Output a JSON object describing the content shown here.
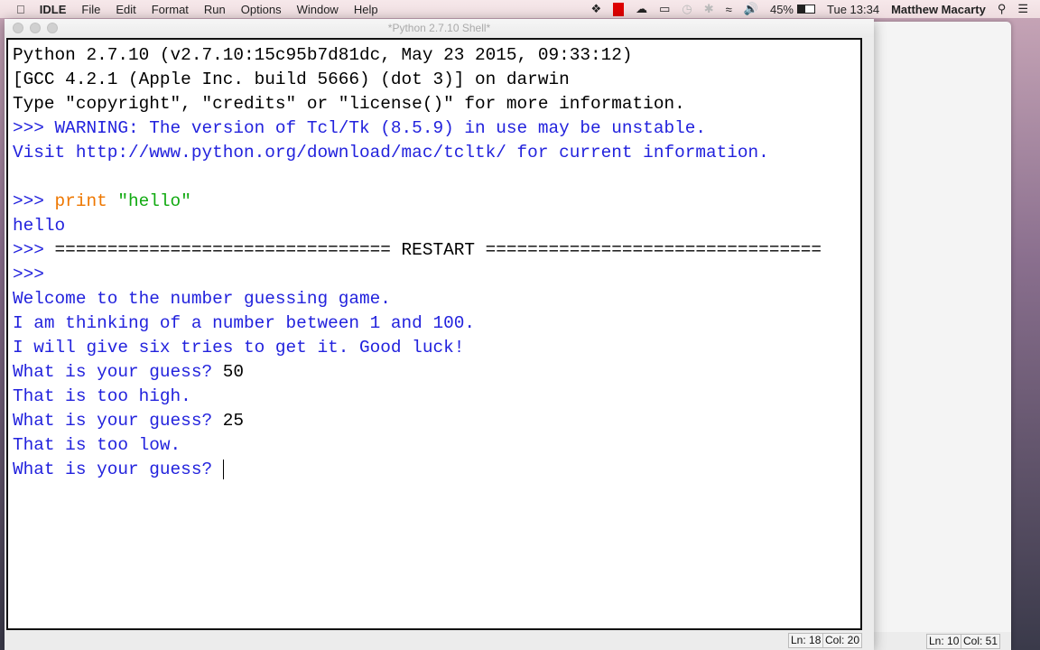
{
  "menubar": {
    "app": "IDLE",
    "items": [
      "File",
      "Edit",
      "Format",
      "Run",
      "Options",
      "Window",
      "Help"
    ],
    "battery": "45%",
    "clock": "Tue 13:34",
    "user": "Matthew Macarty"
  },
  "window": {
    "title": "*Python 2.7.10 Shell*"
  },
  "shell": {
    "lines": [
      [
        {
          "t": "Python 2.7.10 (v2.7.10:15c95b7d81dc, May 23 2015, 09:33:12)",
          "c": "blk"
        }
      ],
      [
        {
          "t": "[GCC 4.2.1 (Apple Inc. build 5666) (dot 3)] on darwin",
          "c": "blk"
        }
      ],
      [
        {
          "t": "Type \"copyright\", \"credits\" or \"license()\" for more information.",
          "c": "blk"
        }
      ],
      [
        {
          "t": ">>> WARNING: The version of Tcl/Tk (8.5.9) in use may be unstable.",
          "c": "blu"
        }
      ],
      [
        {
          "t": "Visit http://www.python.org/download/mac/tcltk/ for current information.",
          "c": "blu"
        }
      ],
      [
        {
          "t": "",
          "c": "blk"
        }
      ],
      [
        {
          "t": ">>> ",
          "c": "blu"
        },
        {
          "t": "print ",
          "c": "org"
        },
        {
          "t": "\"hello\"",
          "c": "grn"
        }
      ],
      [
        {
          "t": "hello",
          "c": "blu"
        }
      ],
      [
        {
          "t": ">>> ",
          "c": "blu"
        },
        {
          "t": "================================ RESTART ================================",
          "c": "blk"
        }
      ],
      [
        {
          "t": ">>> ",
          "c": "blu"
        }
      ],
      [
        {
          "t": "Welcome to the number guessing game.",
          "c": "blu"
        }
      ],
      [
        {
          "t": "I am thinking of a number between 1 and 100.",
          "c": "blu"
        }
      ],
      [
        {
          "t": "I will give six tries to get it. Good luck!",
          "c": "blu"
        }
      ],
      [
        {
          "t": "What is your guess? ",
          "c": "blu"
        },
        {
          "t": "50",
          "c": "blk"
        }
      ],
      [
        {
          "t": "That is too high.",
          "c": "blu"
        }
      ],
      [
        {
          "t": "What is your guess? ",
          "c": "blu"
        },
        {
          "t": "25",
          "c": "blk"
        }
      ],
      [
        {
          "t": "That is too low.",
          "c": "blu"
        }
      ],
      [
        {
          "t": "What is your guess? ",
          "c": "blu"
        }
      ]
    ]
  },
  "status": {
    "ln": "Ln: 18",
    "col": "Col: 20"
  },
  "bg_status": {
    "ln": "Ln: 10",
    "col": "Col: 51"
  }
}
